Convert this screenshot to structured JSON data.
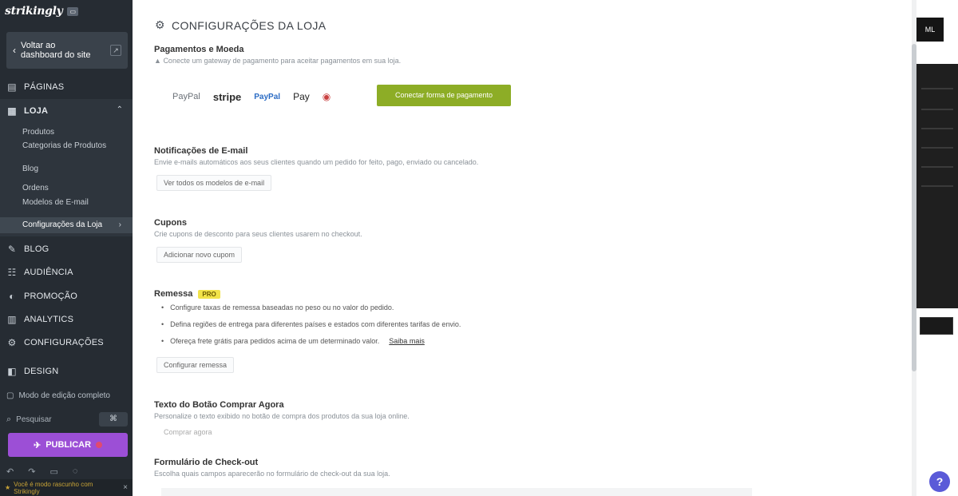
{
  "sidebar": {
    "brand": "strikingly",
    "brand_badge": "",
    "back_label": "Voltar ao dashboard do site",
    "nav": [
      {
        "label": "Páginas",
        "icon": "pages-icon"
      },
      {
        "label": "Loja",
        "icon": "store-icon"
      },
      {
        "label": "Blog",
        "icon": "blog-icon"
      },
      {
        "label": "Audiência",
        "icon": "audience-icon"
      },
      {
        "label": "Promoção",
        "icon": "megaphone-icon"
      },
      {
        "label": "Analytics",
        "icon": "analytics-icon"
      },
      {
        "label": "Configurações",
        "icon": "gear-icon"
      },
      {
        "label": "Design",
        "icon": "design-icon"
      }
    ],
    "store_sub": [
      "Produtos",
      "Categorias de Produtos",
      "Blog",
      "Ordens",
      "Modelos de E-mail",
      "Configurações da Loja"
    ],
    "mode_label": "Modo de edição completo",
    "search_label": "Pesquisar",
    "search_btn": "⌘",
    "publish_label": "Publicar",
    "notice": "Você é modo rascunho com Strikingly"
  },
  "main": {
    "title": "CONFIGURAÇÕES DA LOJA",
    "payments": {
      "heading": "Pagamentos e Moeda",
      "desc": "Conecte um gateway de pagamento para aceitar pagamentos em sua loja.",
      "logos": [
        "PayPal",
        "stripe",
        "PayPal",
        "Pay",
        "MC"
      ],
      "connect_btn": "Conectar forma de pagamento"
    },
    "notifications": {
      "heading": "Notificações de E-mail",
      "desc": "Envie e-mails automáticos aos seus clientes quando um pedido for feito, pago, enviado ou cancelado.",
      "button": "Ver todos os modelos de e-mail"
    },
    "coupons": {
      "heading": "Cupons",
      "desc": "Crie cupons de desconto para seus clientes usarem no checkout.",
      "button": "Adicionar novo cupom"
    },
    "shipping": {
      "heading": "Remessa",
      "badge": "PRO",
      "bullets": [
        "Configure taxas de remessa baseadas no peso ou no valor do pedido.",
        "Defina regiões de entrega para diferentes países e estados com diferentes tarifas de envio.",
        "Ofereça frete grátis para pedidos acima de um determinado valor."
      ],
      "link": "Saiba mais",
      "button": "Configurar remessa"
    },
    "buy_now": {
      "heading": "Texto do Botão Comprar Agora",
      "desc": "Personalize o texto exibido no botão de compra dos produtos da sua loja online.",
      "value": "Comprar agora"
    },
    "checkout": {
      "heading": "Formulário de Check-out",
      "desc": "Escolha quais campos aparecerão no formulário de check-out da sua loja."
    }
  },
  "preview": {
    "top_label": "ML"
  },
  "help_label": "?"
}
